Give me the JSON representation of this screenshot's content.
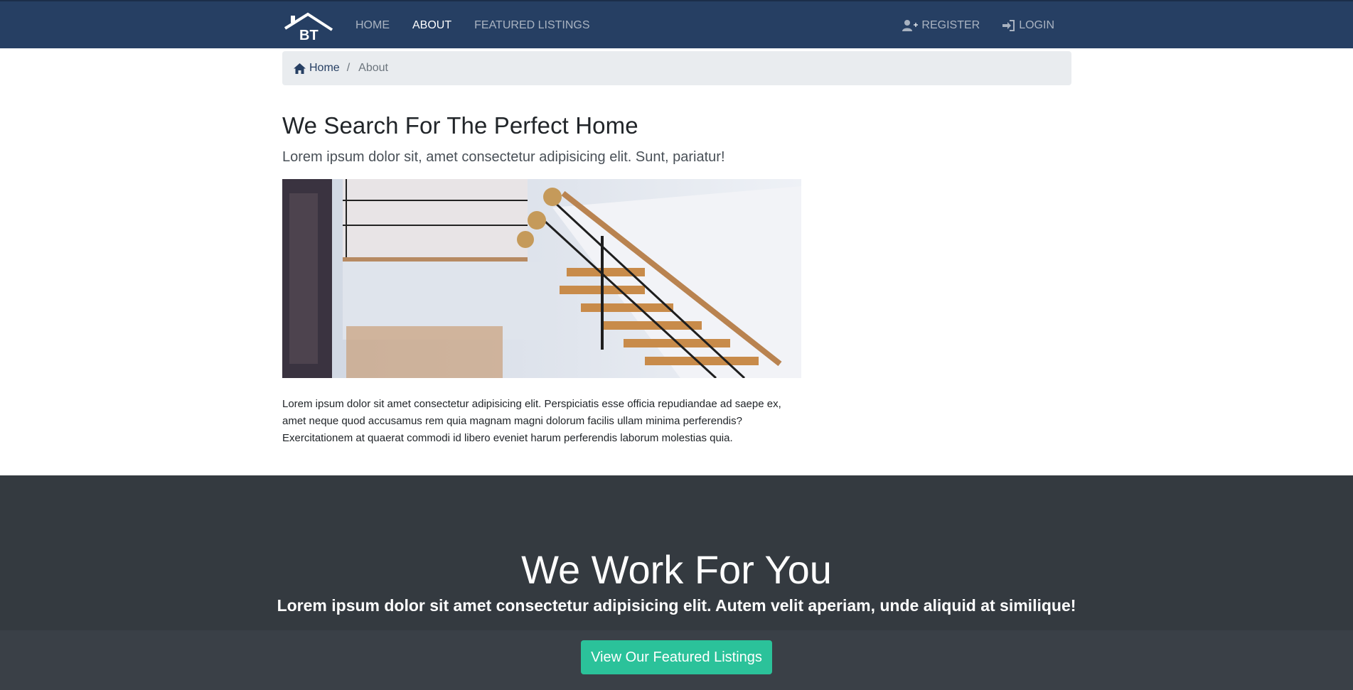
{
  "navbar": {
    "brand_text": "BT",
    "links": [
      {
        "label": "HOME",
        "active": false
      },
      {
        "label": "ABOUT",
        "active": true
      },
      {
        "label": "FEATURED LISTINGS",
        "active": false
      }
    ],
    "register_label": "REGISTER",
    "login_label": "LOGIN",
    "register_icon": "user-plus-icon",
    "login_icon": "sign-in-icon"
  },
  "breadcrumb": {
    "home_label": "Home",
    "separator": "/",
    "current_label": "About",
    "home_icon": "home-icon"
  },
  "about": {
    "title": "We Search For The Perfect Home",
    "lead": "Lorem ipsum dolor sit, amet consectetur adipisicing elit. Sunt, pariatur!",
    "image_description": "staircase interior photo",
    "body": "Lorem ipsum dolor sit amet consectetur adipisicing elit. Perspiciatis esse officia repudiandae ad saepe ex, amet neque quod accusamus rem quia magnam magni dolorum facilis ullam minima perferendis? Exercitationem at quaerat commodi id libero eveniet harum perferendis laborum molestias quia."
  },
  "work": {
    "title": "We Work For You",
    "lead": "Lorem ipsum dolor sit amet consectetur adipisicing elit. Autem velit aperiam, unde aliquid at similique!",
    "button_label": "View Our Featured Listings"
  },
  "colors": {
    "navbar_bg": "#263f63",
    "section_dark": "#343a40",
    "accent_button": "#2bc29a",
    "breadcrumb_bg": "#e9ecef"
  }
}
